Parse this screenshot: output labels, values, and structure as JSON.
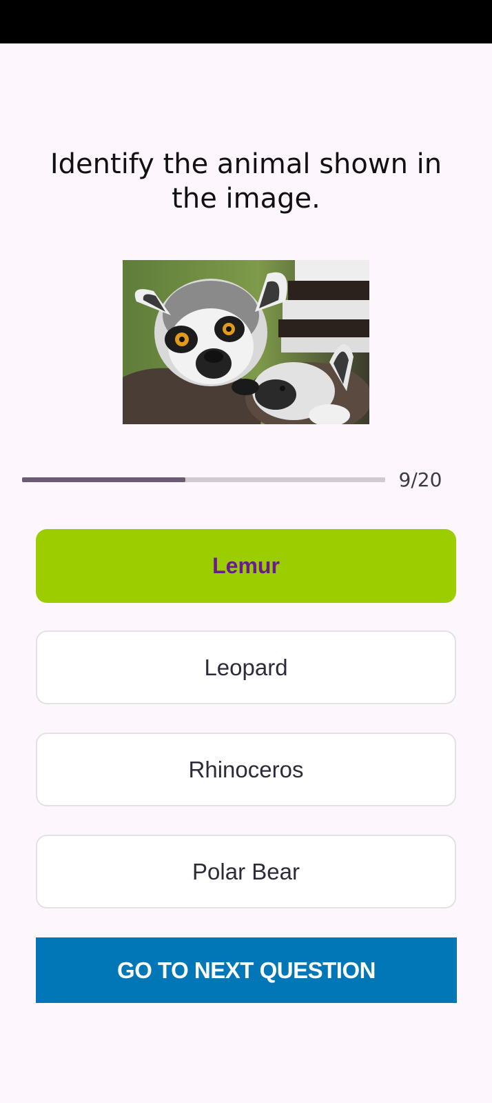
{
  "quiz": {
    "question": "Identify the animal shown in the image.",
    "image_subject": "lemur-photo",
    "progress": {
      "current": 9,
      "total": 20,
      "label": "9/20",
      "fraction": 0.45
    },
    "options": [
      {
        "label": "Lemur",
        "state": "correct"
      },
      {
        "label": "Leopard",
        "state": "default"
      },
      {
        "label": "Rhinoceros",
        "state": "default"
      },
      {
        "label": "Polar Bear",
        "state": "default"
      }
    ],
    "next_button_label": "GO TO NEXT QUESTION"
  },
  "colors": {
    "background": "#fdf6fd",
    "correct": "#9ccd00",
    "correct_text": "#6a1b8f",
    "primary": "#0277b8",
    "progress_fill": "#6b5b73",
    "progress_track": "#cfcbd1"
  }
}
